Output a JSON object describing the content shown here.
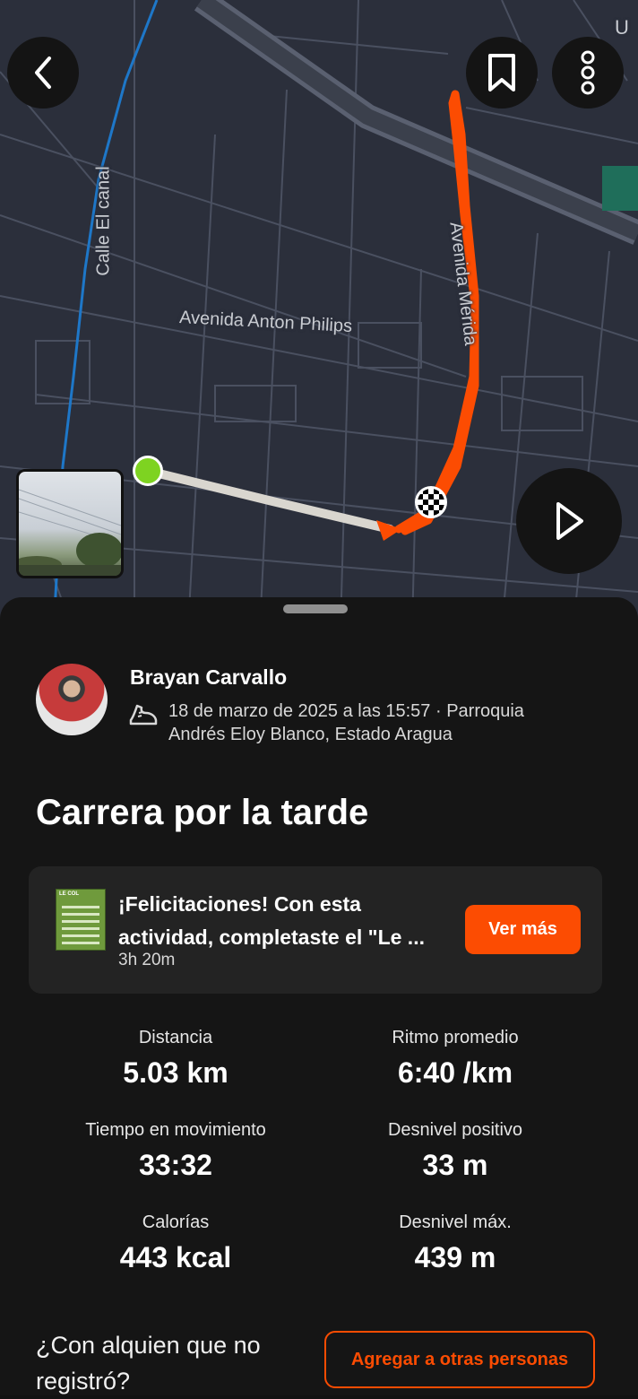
{
  "map": {
    "labels": {
      "calle_el_canal": "Calle El canal",
      "avenida_anton_philips": "Avenida Anton Philips",
      "avenida_merida": "Avenida Mérida",
      "corner_u": "U"
    },
    "route_color": "#fc4c02",
    "start_color": "#7ed321"
  },
  "buttons": {
    "back_icon": "chevron-left-icon",
    "bookmark_icon": "bookmark-icon",
    "more_icon": "more-vertical-icon",
    "play_icon": "play-icon"
  },
  "athlete": {
    "name": "Brayan Carvallo",
    "datetime_location": "18 de marzo de 2025 a las 15:57 · Parroquia Andrés Eloy Blanco, Estado Aragua",
    "activity_icon": "running-shoe-icon"
  },
  "activity": {
    "title": "Carrera por la tarde"
  },
  "achievement": {
    "thumb_title": "LE COL",
    "text": "¡Felicitaciones! Con esta actividad, completaste el \"Le ...",
    "duration": "3h 20m",
    "button": "Ver más"
  },
  "stats": {
    "distance_label": "Distancia",
    "distance_value": "5.03 km",
    "pace_label": "Ritmo promedio",
    "pace_value": "6:40 /km",
    "moving_time_label": "Tiempo en movimiento",
    "moving_time_value": "33:32",
    "elev_gain_label": "Desnivel positivo",
    "elev_gain_value": "33 m",
    "calories_label": "Calorías",
    "calories_value": "443 kcal",
    "max_elev_label": "Desnivel máx.",
    "max_elev_value": "439 m"
  },
  "footer": {
    "prompt": "¿Con alquien que no registró?",
    "add_button": "Agregar a otras personas"
  },
  "colors": {
    "accent": "#fc4c02",
    "sheet_bg": "#151515",
    "card_bg": "#232323"
  }
}
